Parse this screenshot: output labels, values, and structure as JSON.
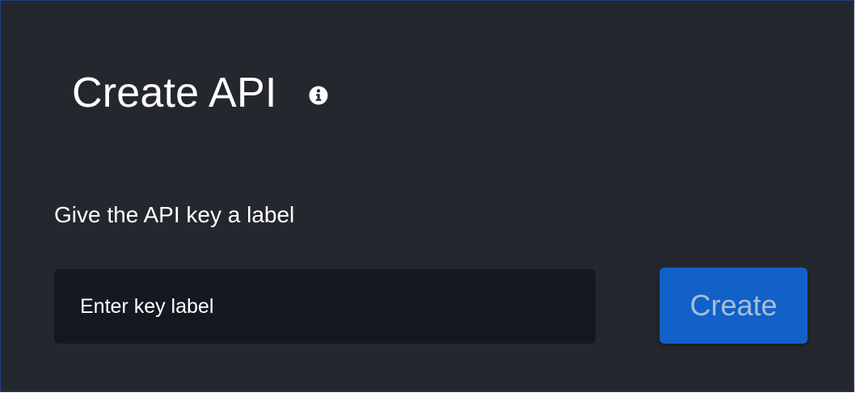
{
  "dialog": {
    "title": "Create API",
    "info_icon": "info-circle-icon",
    "field_label": "Give the API key a label",
    "input": {
      "value": "",
      "placeholder": "Enter key label"
    },
    "create_label": "Create"
  },
  "colors": {
    "panel_background": "#25272f",
    "input_background": "#151820",
    "button_background": "#1161c9",
    "button_text": "#a9bdd6",
    "text": "#ffffff"
  }
}
